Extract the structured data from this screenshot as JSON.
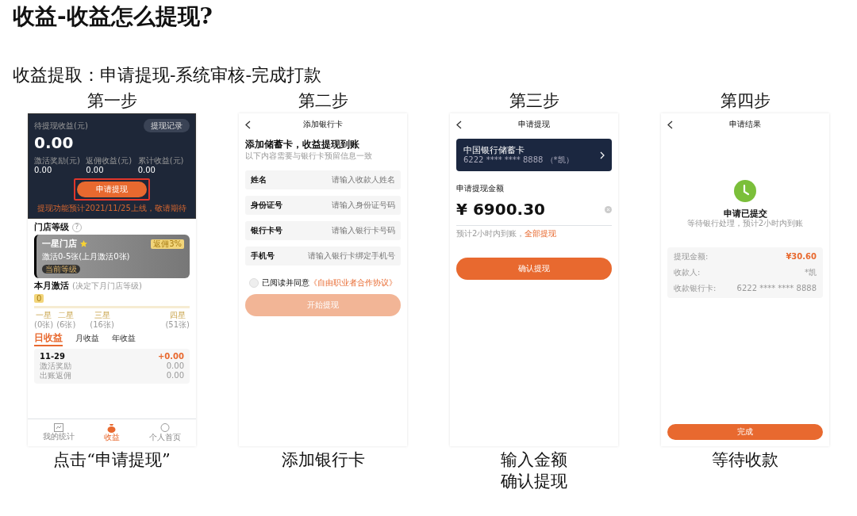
{
  "title": "收益-收益怎么提现?",
  "subtitle": "收益提取：申请提现-系统审核-完成打款",
  "steps": [
    {
      "kind": "earnings",
      "heading": "第一步",
      "caption": [
        "点击“申请提现”"
      ],
      "screen": {
        "balance_label": "待提现收益(元)",
        "records_button": "提现记录",
        "balance": "0.00",
        "stats": [
          {
            "label": "激活奖励(元)",
            "value": "0.00"
          },
          {
            "label": "返佣收益(元)",
            "value": "0.00"
          },
          {
            "label": "累计收益(元)",
            "value": "0.00"
          }
        ],
        "withdraw_button": {
          "label": "申请提现",
          "highlighted": true
        },
        "notice": "提现功能预计2021/11/25上线，敬请期待",
        "level_title": "门店等级",
        "help_icon": "?",
        "level_card": {
          "name": "一星门店",
          "badge": "返佣3%",
          "description": "激活0-5张(上月激活0张)",
          "current_tag": "当前等级"
        },
        "activation_title": "本月激活",
        "activation_note": "(决定下月门店等级)",
        "activation_count": "0",
        "level": 0,
        "milestones": [
          {
            "label": "一星",
            "sub": "(0张)"
          },
          {
            "label": "二星",
            "sub": "(6张)"
          },
          {
            "label": "三星",
            "sub": "(16张)"
          },
          {
            "label": "四星",
            "sub": "(51张)"
          }
        ],
        "tabs": [
          {
            "label": "日收益",
            "selected": true
          },
          {
            "label": "月收益",
            "selected": false
          },
          {
            "label": "年收益",
            "selected": false
          }
        ],
        "daily": {
          "date": "11-29",
          "total": "+0.00",
          "rows": [
            {
              "label": "激活奖励",
              "value": "0.00"
            },
            {
              "label": "出账返佣",
              "value": "0.00"
            }
          ]
        },
        "nav": [
          {
            "label": "我的统计",
            "kind": "chart",
            "selected": false
          },
          {
            "label": "收益",
            "kind": "bag",
            "selected": true
          },
          {
            "label": "个人首页",
            "kind": "chat",
            "selected": false
          }
        ]
      }
    },
    {
      "kind": "bank",
      "heading": "第二步",
      "caption": [
        "添加银行卡"
      ],
      "screen": {
        "nav_title": "添加银行卡",
        "heading": "添加储蓄卡，收益提现到账",
        "hint": "以下内容需要与银行卡预留信息一致",
        "fields": [
          {
            "label": "姓名",
            "placeholder": "请输入收款人姓名"
          },
          {
            "label": "身份证号",
            "placeholder": "请输入身份证号码"
          },
          {
            "label": "银行卡号",
            "placeholder": "请输入银行卡号码"
          },
          {
            "label": "手机号",
            "placeholder": "请输入银行卡绑定手机号"
          }
        ],
        "agreement": {
          "checked": false,
          "text": "已阅读并同意",
          "link": "《自由职业者合作协议》"
        },
        "submit": {
          "label": "开始提现",
          "disabled": true
        }
      }
    },
    {
      "kind": "amount",
      "heading": "第三步",
      "caption": [
        "输入金额",
        "确认提现"
      ],
      "screen": {
        "nav_title": "申请提现",
        "card": {
          "bank": "中国银行储蓄卡",
          "number": "6222 **** **** 8888 （*凯）"
        },
        "amount_label": "申请提现金额",
        "amount": "¥ 6900.30",
        "eta": "预计2小时内到账，",
        "all_link": "全部提现",
        "confirm_button": "确认提现"
      }
    },
    {
      "kind": "result",
      "heading": "第四步",
      "caption": [
        "等待收款"
      ],
      "screen": {
        "nav_title": "申请结果",
        "status_title": "申请已提交",
        "status_text": "等待银行处理，预计2小时内到账",
        "details": [
          {
            "label": "提现金额:",
            "value": "¥30.60",
            "kind": "amount"
          },
          {
            "label": "收款人:",
            "value": "*凯",
            "kind": "text"
          },
          {
            "label": "收款银行卡:",
            "value": "6222 **** **** 8888",
            "kind": "text"
          }
        ],
        "done_button": "完成"
      }
    }
  ]
}
